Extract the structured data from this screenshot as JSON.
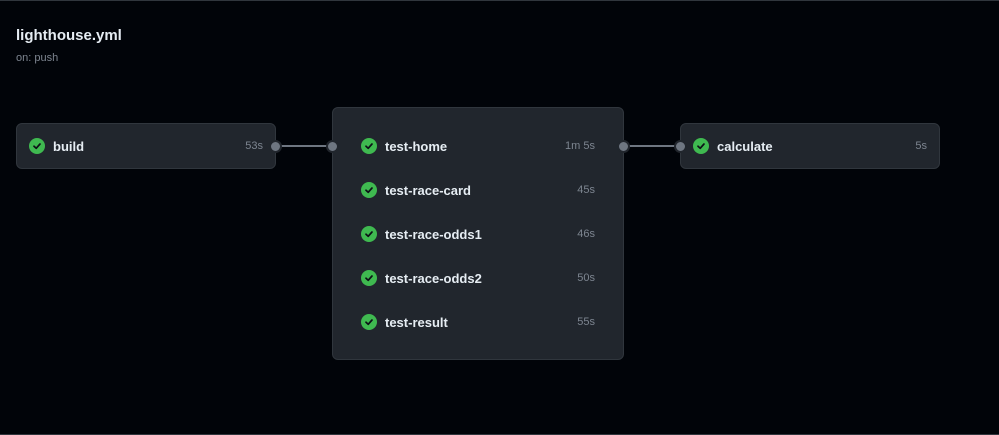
{
  "workflow": {
    "title": "lighthouse.yml",
    "trigger": "on: push"
  },
  "colors": {
    "background": "#010409",
    "card": "#21262d",
    "border": "#30363d",
    "success": "#3fb950",
    "text": "#e6edf3",
    "muted": "#7d8590",
    "connector": "#6e7681"
  },
  "stages": [
    {
      "jobs": [
        {
          "name": "build",
          "duration": "53s",
          "status": "success",
          "status_icon": "check-circle-icon"
        }
      ]
    },
    {
      "jobs": [
        {
          "name": "test-home",
          "duration": "1m 5s",
          "status": "success",
          "status_icon": "check-circle-icon"
        },
        {
          "name": "test-race-card",
          "duration": "45s",
          "status": "success",
          "status_icon": "check-circle-icon"
        },
        {
          "name": "test-race-odds1",
          "duration": "46s",
          "status": "success",
          "status_icon": "check-circle-icon"
        },
        {
          "name": "test-race-odds2",
          "duration": "50s",
          "status": "success",
          "status_icon": "check-circle-icon"
        },
        {
          "name": "test-result",
          "duration": "55s",
          "status": "success",
          "status_icon": "check-circle-icon"
        }
      ]
    },
    {
      "jobs": [
        {
          "name": "calculate",
          "duration": "5s",
          "status": "success",
          "status_icon": "check-circle-icon"
        }
      ]
    }
  ]
}
